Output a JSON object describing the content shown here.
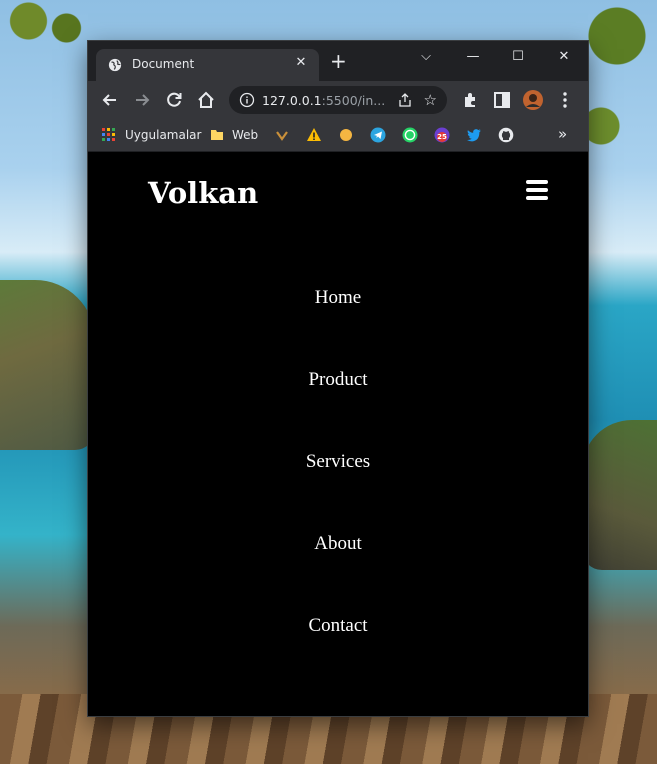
{
  "desktop": {
    "wallpaper": "beach-cliffs"
  },
  "browser": {
    "tab": {
      "title": "Document",
      "favicon": "globe-icon",
      "close": "✕"
    },
    "new_tab": "+",
    "window_controls": {
      "dropdown": "⌵",
      "minimize": "—",
      "maximize": "☐",
      "close": "✕"
    },
    "address": {
      "host": "127.0.0.1",
      "rest": ":5500/in..."
    },
    "bookmarks": [
      {
        "label": "Uygulamalar",
        "icon": "apps-grid-icon"
      },
      {
        "label": "Web",
        "icon": "folder-icon"
      },
      {
        "label": "",
        "icon": "vivaldi-icon"
      },
      {
        "label": "",
        "icon": "warning-icon"
      },
      {
        "label": "",
        "icon": "circle-icon"
      },
      {
        "label": "",
        "icon": "telegram-icon"
      },
      {
        "label": "",
        "icon": "whatsapp-icon"
      },
      {
        "label": "",
        "icon": "calendar-badge-icon",
        "badge": "25"
      },
      {
        "label": "",
        "icon": "twitter-icon"
      },
      {
        "label": "",
        "icon": "github-icon"
      }
    ],
    "more_bookmarks": "»"
  },
  "site": {
    "logo": "Volkan",
    "menu_icon": "hamburger-icon",
    "nav": [
      "Home",
      "Product",
      "Services",
      "About",
      "Contact"
    ]
  },
  "colors": {
    "page_bg": "#000000",
    "text": "#ffffff",
    "chrome_dark": "#202124",
    "chrome_tab": "#35363a"
  }
}
